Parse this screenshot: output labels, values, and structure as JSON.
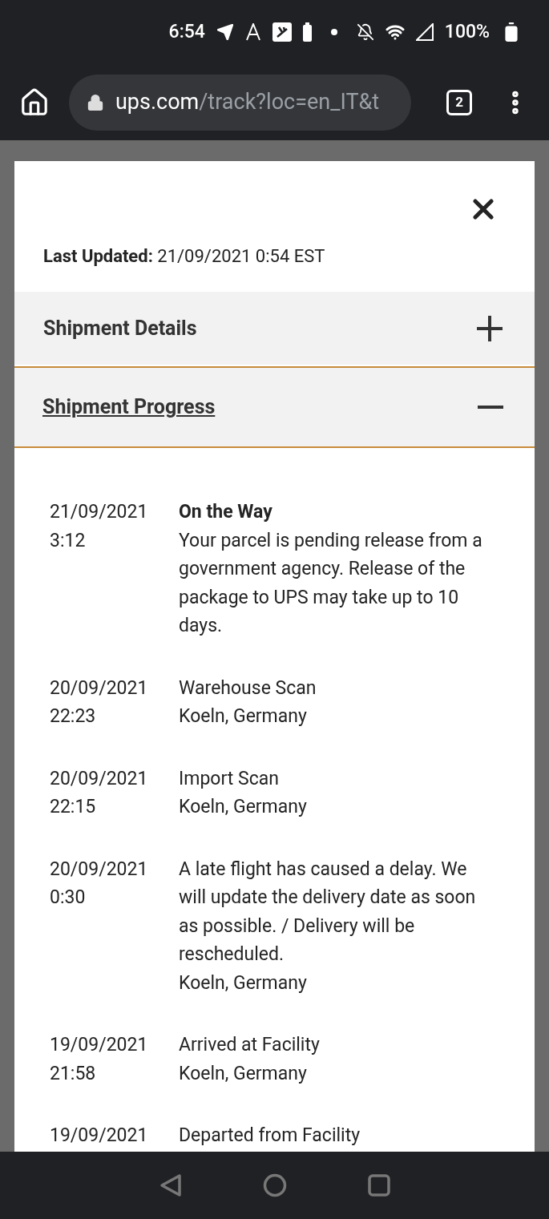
{
  "status_bar": {
    "time": "6:54",
    "battery": "100%"
  },
  "browser": {
    "url_host": "ups.com",
    "url_path": "/track?loc=en_IT&t",
    "tab_count": "2"
  },
  "modal": {
    "last_updated_label": "Last Updated:",
    "last_updated_value": "21/09/2021 0:54 EST",
    "sections": [
      {
        "label": "Shipment Details",
        "expanded": false,
        "focused": false
      },
      {
        "label": "Shipment Progress",
        "expanded": true,
        "focused": true
      }
    ],
    "events": [
      {
        "date": "21/09/2021",
        "time": "3:12",
        "status": "On the Way",
        "emphasis": true,
        "detail": "Your parcel is pending release from a government agency. Release of the package to UPS may take up to 10 days."
      },
      {
        "date": "20/09/2021",
        "time": "22:23",
        "status": "Warehouse Scan",
        "emphasis": false,
        "location": "Koeln, Germany"
      },
      {
        "date": "20/09/2021",
        "time": "22:15",
        "status": "Import Scan",
        "emphasis": false,
        "location": "Koeln, Germany"
      },
      {
        "date": "20/09/2021",
        "time": "0:30",
        "status": "A late flight has caused a delay. We will update the delivery date as soon as possible. / Delivery will be rescheduled.",
        "emphasis": false,
        "location": "Koeln, Germany"
      },
      {
        "date": "19/09/2021",
        "time": "21:58",
        "status": "Arrived at Facility",
        "emphasis": false,
        "location": "Koeln, Germany"
      },
      {
        "date": "19/09/2021",
        "status": "Departed from Facility",
        "emphasis": false
      }
    ]
  }
}
